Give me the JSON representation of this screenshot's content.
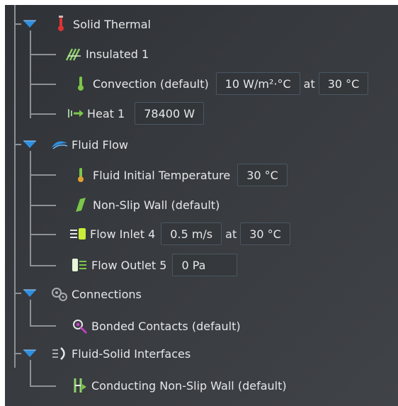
{
  "tree": {
    "solid_thermal": {
      "label": "Solid Thermal",
      "icon": "thermometer-red-icon",
      "children": {
        "insulated": {
          "label": "Insulated 1",
          "icon": "insulation-icon"
        },
        "convection": {
          "label": "Convection (default)",
          "icon": "thermometer-green-icon",
          "value1": "10 W/m²·°C",
          "at": "at",
          "value2": "30 °C"
        },
        "heat": {
          "label": "Heat 1",
          "icon": "heat-flow-icon",
          "value": "78400 W"
        }
      }
    },
    "fluid_flow": {
      "label": "Fluid Flow",
      "icon": "fluid-wave-icon",
      "children": {
        "initial_temp": {
          "label": "Fluid Initial Temperature",
          "icon": "thermometer-green-icon",
          "value": "30 °C"
        },
        "non_slip": {
          "label": "Non-Slip Wall (default)",
          "icon": "wall-green-icon"
        },
        "inlet": {
          "label": "Flow Inlet 4",
          "icon": "flow-inlet-icon",
          "value1": "0.5 m/s",
          "at": "at",
          "value2": "30 °C"
        },
        "outlet": {
          "label": "Flow Outlet 5",
          "icon": "flow-outlet-icon",
          "value": "0 Pa"
        }
      }
    },
    "connections": {
      "label": "Connections",
      "icon": "gears-icon",
      "children": {
        "bonded": {
          "label": "Bonded Contacts (default)",
          "icon": "bonded-contact-icon"
        }
      }
    },
    "fluid_solid": {
      "label": "Fluid-Solid Interfaces",
      "icon": "interface-icon",
      "children": {
        "conducting": {
          "label": "Conducting Non-Slip Wall (default)",
          "icon": "conducting-wall-icon"
        }
      }
    }
  },
  "colors": {
    "background": "#36393d",
    "tree_line": "#8d9196",
    "caret": "#2f8fe0",
    "text": "#e6e7e9",
    "field_border": "#4a5764"
  }
}
